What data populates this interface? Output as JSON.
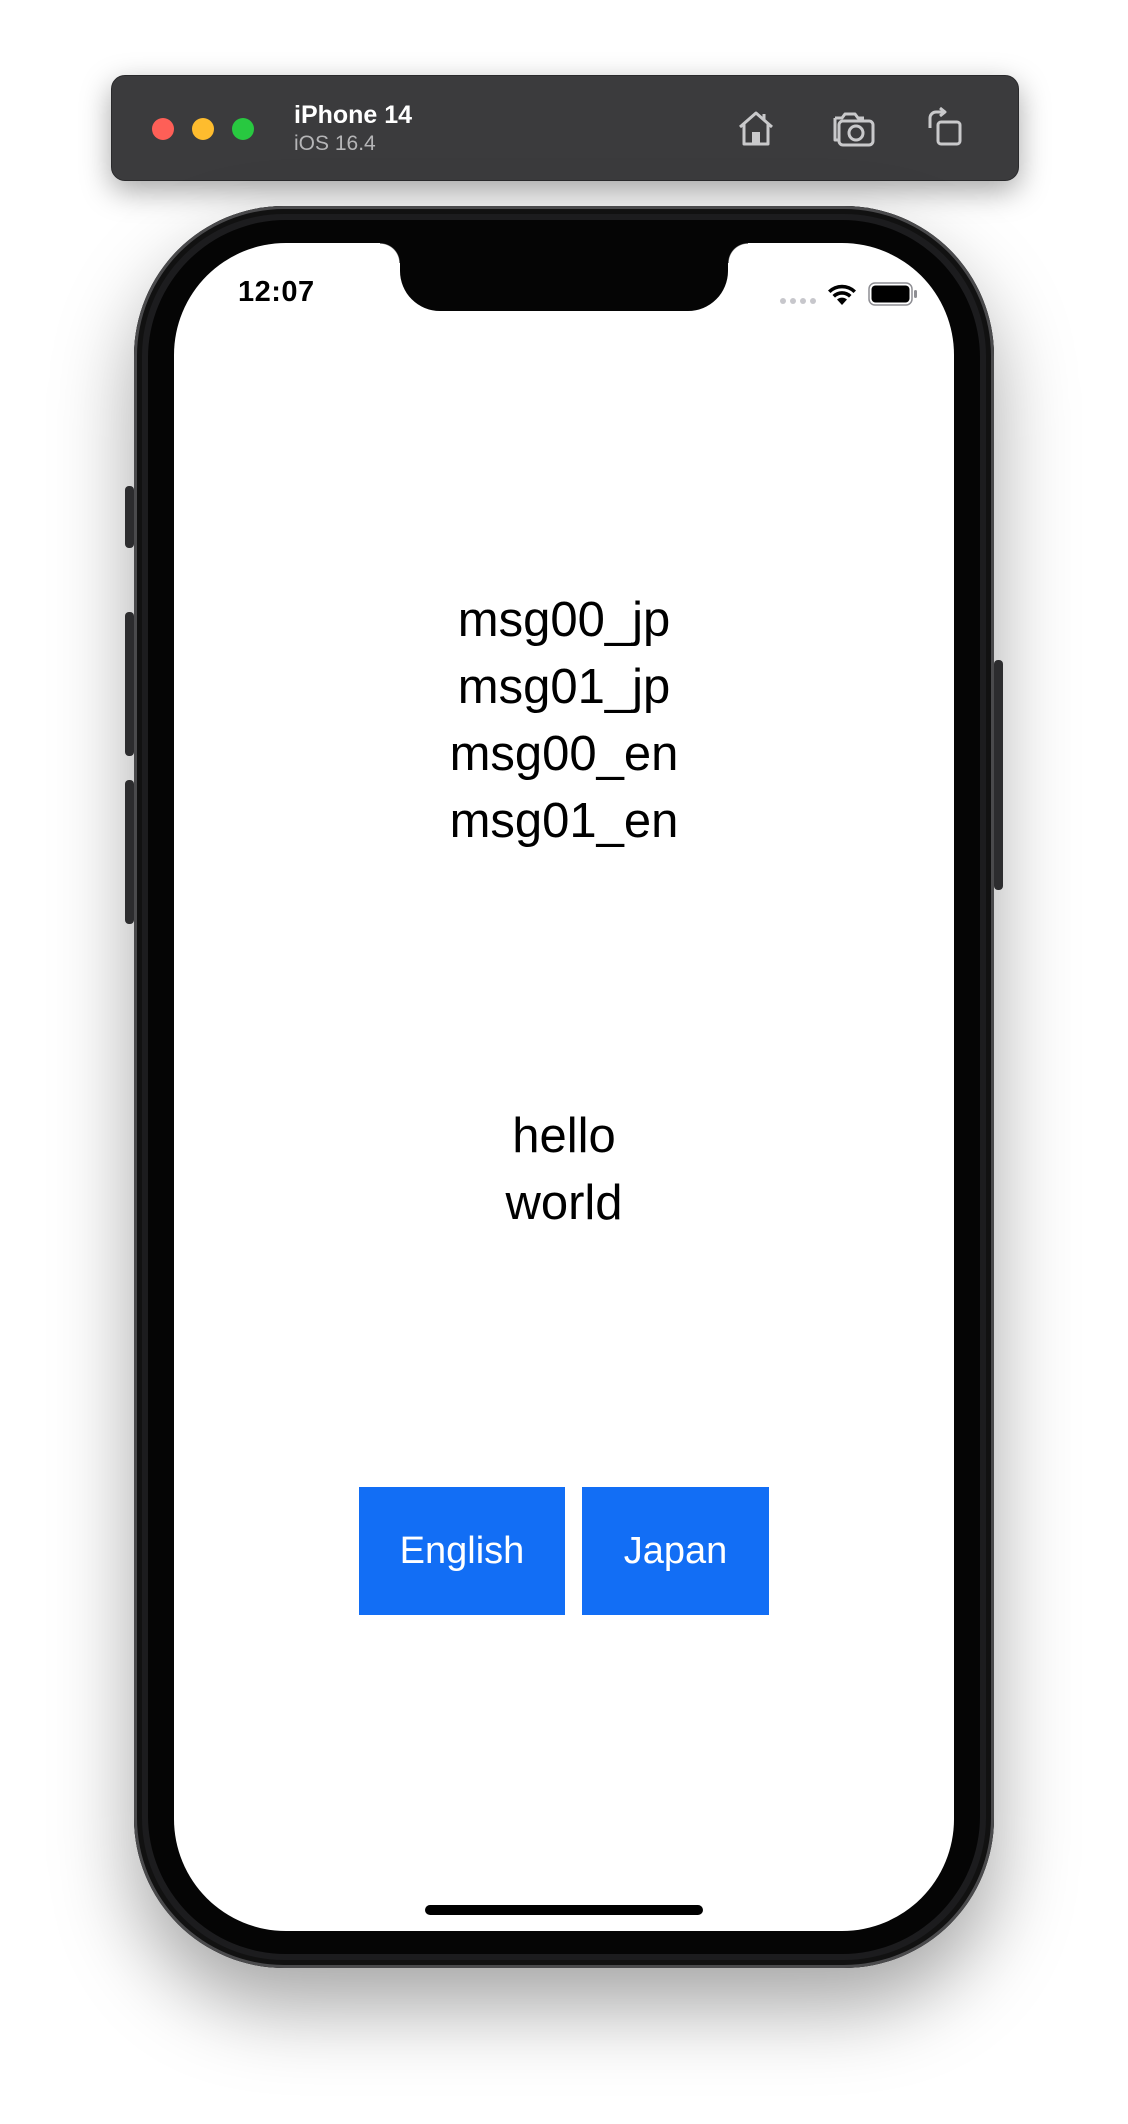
{
  "simulator": {
    "device_name": "iPhone 14",
    "os_version": "iOS 16.4",
    "icons": [
      "home-icon",
      "screenshot-camera-icon",
      "rotate-icon"
    ]
  },
  "status_bar": {
    "time": "12:07",
    "icons": [
      "signal-dots-icon",
      "wifi-icon",
      "battery-icon"
    ]
  },
  "messages": {
    "lines": [
      "msg00_jp",
      "msg01_jp",
      "msg00_en",
      "msg01_en"
    ]
  },
  "greeting": {
    "lines": [
      "hello",
      "world"
    ]
  },
  "buttons": {
    "english_label": "English",
    "japan_label": "Japan"
  },
  "colors": {
    "button_blue": "#126ef5",
    "toolbar_bg": "#3b3b3d",
    "traffic_red": "#fe5f57",
    "traffic_yellow": "#febc2e",
    "traffic_green": "#28c840"
  }
}
